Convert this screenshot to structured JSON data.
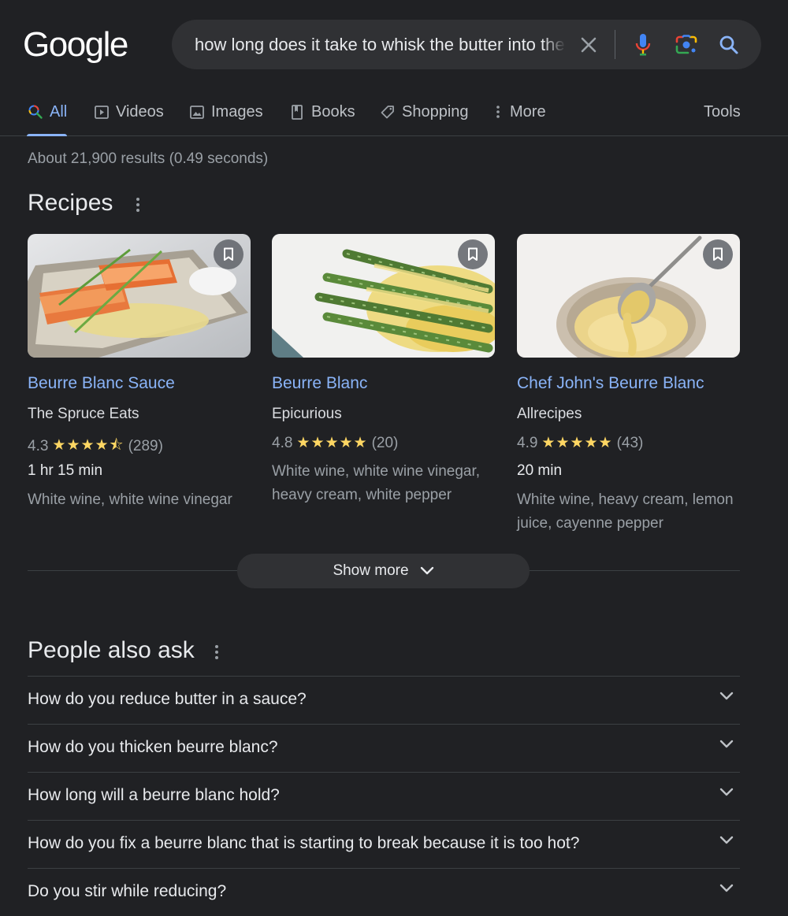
{
  "header": {
    "logo_text": "Google",
    "query": "how long does it take to whisk the butter into the sauce",
    "clear_icon": "close-icon",
    "voice_icon": "microphone-icon",
    "lens_icon": "camera-lens-icon",
    "search_icon": "search-icon"
  },
  "tabs": [
    {
      "label": "All",
      "icon": "search-icon",
      "active": true
    },
    {
      "label": "Videos",
      "icon": "play-icon"
    },
    {
      "label": "Images",
      "icon": "image-icon"
    },
    {
      "label": "Books",
      "icon": "book-icon"
    },
    {
      "label": "Shopping",
      "icon": "tag-icon"
    },
    {
      "label": "More",
      "icon": "more-vert-icon"
    }
  ],
  "tools_label": "Tools",
  "result_stats": "About 21,900 results (0.49 seconds)",
  "recipes": {
    "title": "Recipes",
    "cards": [
      {
        "title": "Beurre Blanc Sauce",
        "source": "The Spruce Eats",
        "rating": "4.3",
        "stars": "★★★★⯪",
        "reviews": "(289)",
        "time": "1 hr 15 min",
        "ingredients": "White wine, white wine vinegar",
        "image": "salmon fillets with sauce"
      },
      {
        "title": "Beurre Blanc",
        "source": "Epicurious",
        "rating": "4.8",
        "stars": "★★★★★",
        "reviews": "(20)",
        "time": "",
        "ingredients": "White wine, white wine vinegar, heavy cream, white pepper",
        "image": "asparagus with sauce"
      },
      {
        "title": "Chef John's Beurre Blanc",
        "source": "Allrecipes",
        "rating": "4.9",
        "stars": "★★★★★",
        "reviews": "(43)",
        "time": "20 min",
        "ingredients": "White wine, heavy cream, lemon juice, cayenne pepper",
        "image": "spoon pouring sauce into bowl"
      }
    ],
    "show_more": "Show more"
  },
  "people_also_ask": {
    "title": "People also ask",
    "questions": [
      "How do you reduce butter in a sauce?",
      "How do you thicken beurre blanc?",
      "How long will a beurre blanc hold?",
      "How do you fix a beurre blanc that is starting to break because it is too hot?",
      "Do you stir while reducing?"
    ]
  },
  "colors": {
    "background": "#202124",
    "link": "#8ab4f8",
    "star": "#fdd663",
    "searchbox": "#303134"
  }
}
